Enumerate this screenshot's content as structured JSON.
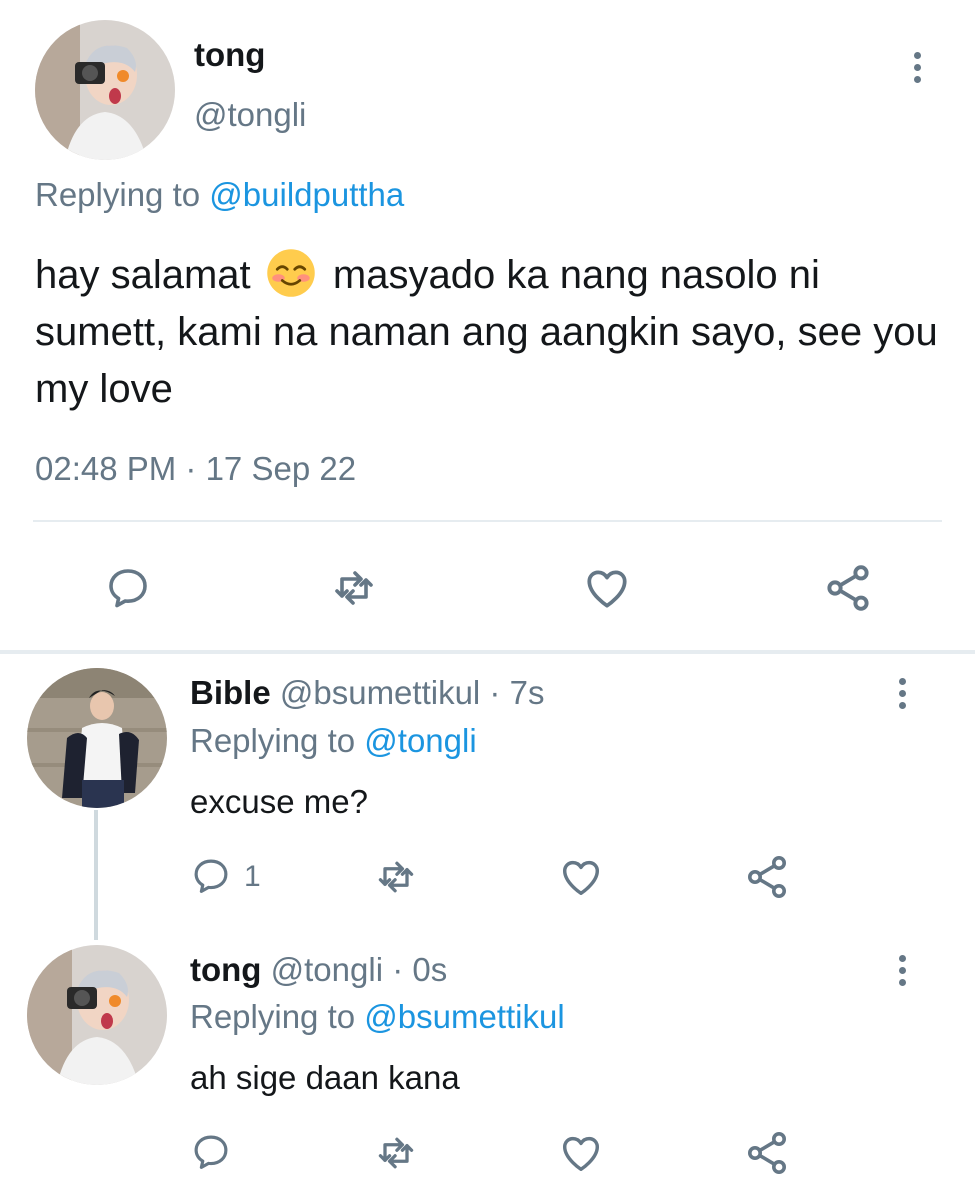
{
  "main_tweet": {
    "name": "tong",
    "handle": "@tongli",
    "replying_prefix": "Replying to",
    "replying_handle": "@buildputtha",
    "text_part1": "hay salamat",
    "emoji": "smiling-face-with-smiling-eyes",
    "text_part2": "masyado ka nang nasolo ni sumett, kami na naman ang aangkin sayo, see you my love",
    "timestamp": "02:48 PM · 17 Sep 22",
    "actions": [
      "reply-icon",
      "retweet-icon",
      "like-icon",
      "share-icon"
    ]
  },
  "replies": [
    {
      "name": "Bible",
      "handle_meta": "@bsumettikul · 7s",
      "replying_prefix": "Replying to",
      "replying_handle": "@tongli",
      "text": "excuse me?",
      "reply_count": "1"
    },
    {
      "name": "tong",
      "handle_meta": "@tongli · 0s",
      "replying_prefix": "Replying to",
      "replying_handle": "@bsumettikul",
      "text": "ah sige daan kana",
      "reply_count": ""
    }
  ],
  "colors": {
    "text": "#14171a",
    "secondary": "#657786",
    "link": "#1b95e0",
    "divider": "#e6ecf0"
  }
}
